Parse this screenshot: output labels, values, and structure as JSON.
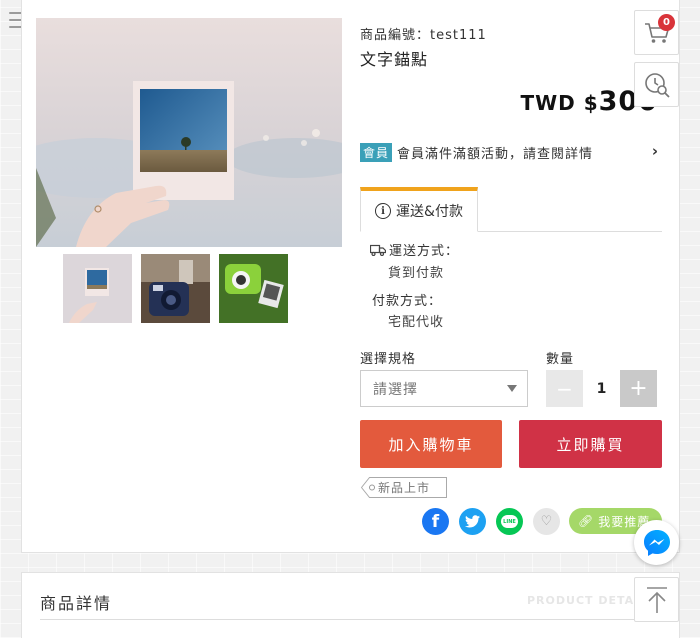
{
  "product": {
    "sku_label": "商品編號：",
    "sku_value": "test111",
    "title": "文字錨點",
    "currency": "TWD $",
    "price": "300"
  },
  "member": {
    "badge": "會員",
    "text": "會員滿件滿額活動，請查閱詳情",
    "chevron": "›"
  },
  "tabs": [
    {
      "label": "運送&付款",
      "icon": "info-icon",
      "active": true
    }
  ],
  "shipping": {
    "label": "運送方式：",
    "value": "貨到付款"
  },
  "payment": {
    "label": "付款方式：",
    "value": "宅配代收"
  },
  "options": {
    "spec_label": "選擇規格",
    "spec_placeholder": "請選擇",
    "qty_label": "數量",
    "qty_value": "1",
    "minus": "−",
    "plus": "+"
  },
  "actions": {
    "add_to_cart": "加入購物車",
    "buy_now": "立即購買"
  },
  "tag": {
    "label": "新品上市"
  },
  "share": {
    "facebook": "f",
    "line": "LINE",
    "recommend": "我要推薦"
  },
  "floating": {
    "cart_count": "0"
  },
  "detail": {
    "title": "商品詳情",
    "subtitle": "PRODUCT DETAIL"
  },
  "colors": {
    "accent_tab": "#f0a31c",
    "member_badge": "#3aa0b8",
    "add_to_cart": "#e35a3d",
    "buy_now": "#d03246",
    "recommend": "#a5d868",
    "cart_badge": "#d9343a"
  }
}
